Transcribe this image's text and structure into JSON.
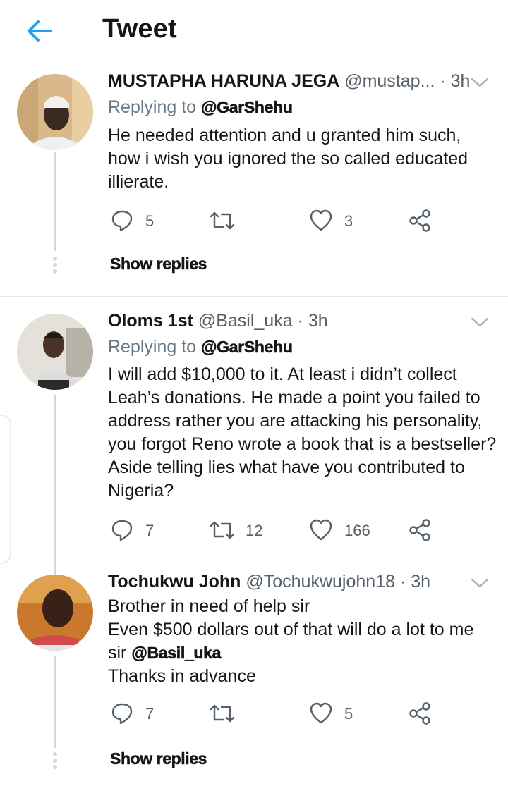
{
  "header": {
    "title": "Tweet",
    "back_icon": "back-arrow-icon",
    "accent": "#1da1f2"
  },
  "tweets": [
    {
      "name": "MUSTAPHA HARUNA JEGA",
      "handle": "@mustap...",
      "time": "· 3h",
      "reply_prefix": "Replying to",
      "reply_handle": "@GarShehu",
      "lines": [
        "He needed attention and u granted him such,",
        "how i wish you ignored the so called educated",
        "illierate."
      ],
      "replies": "5",
      "retweets": "",
      "likes": "3",
      "show_replies": "Show replies"
    },
    {
      "name": "Oloms 1st",
      "handle": "@Basil_uka",
      "time": "· 3h",
      "reply_prefix": "Replying to",
      "reply_handle": "@GarShehu",
      "lines": [
        "I will add $10,000 to it. At least i didn’t collect",
        "Leah’s donations. He made a point you failed to",
        "address rather you are attacking his personality,",
        "you forgot Reno wrote a book that is a bestseller?",
        "Aside telling lies what have you contributed to",
        "Nigeria?"
      ],
      "replies": "7",
      "retweets": "12",
      "likes": "166"
    },
    {
      "name": "Tochukwu John",
      "handle": "@Tochukwujohn18",
      "time": "· 3h",
      "lines": [
        "Brother in need of help sir",
        "Even $500 dollars out of that will do a lot to me"
      ],
      "line3_prefix": "sir",
      "line3_mention": "@Basil_uka",
      "line4": "Thanks in advance",
      "replies": "7",
      "retweets": "",
      "likes": "5",
      "show_replies": "Show replies"
    }
  ],
  "icons": [
    "reply-icon",
    "retweet-icon",
    "like-icon",
    "share-icon",
    "chevron-down-icon"
  ]
}
